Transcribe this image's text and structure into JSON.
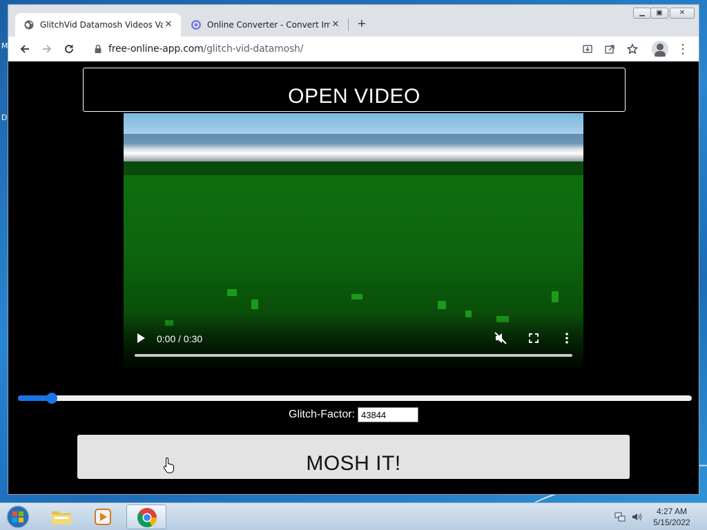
{
  "desktop": {
    "icon_letters": [
      "M",
      "D"
    ]
  },
  "browser": {
    "tabs": [
      {
        "title": "GlitchVid Datamosh Videos Vapo",
        "icon": "globe-icon",
        "active": true
      },
      {
        "title": "Online Converter - Convert Imag",
        "icon": "converter-icon",
        "active": false
      }
    ],
    "new_tab": "+",
    "url": {
      "host": "free-online-app.com",
      "path": "/glitch-vid-datamosh/"
    }
  },
  "page": {
    "open_video_label": "OPEN VIDEO",
    "video": {
      "time": "0:00 / 0:30",
      "progress": 0.0
    },
    "slider": {
      "level": 0.05
    },
    "glitch_factor_label": "Glitch-Factor:",
    "glitch_factor_value": "43844",
    "mosh_button_label": "MOSH IT!"
  },
  "taskbar": {
    "items": [
      "file-explorer-icon",
      "media-player-icon",
      "chrome-icon"
    ],
    "active_item": "chrome-icon",
    "clock_time": "4:27 AM",
    "clock_date": "5/15/2022"
  },
  "colors": {
    "accent": "#1a73e8",
    "page_background": "#000000",
    "video_green": "#0f6e0f"
  }
}
